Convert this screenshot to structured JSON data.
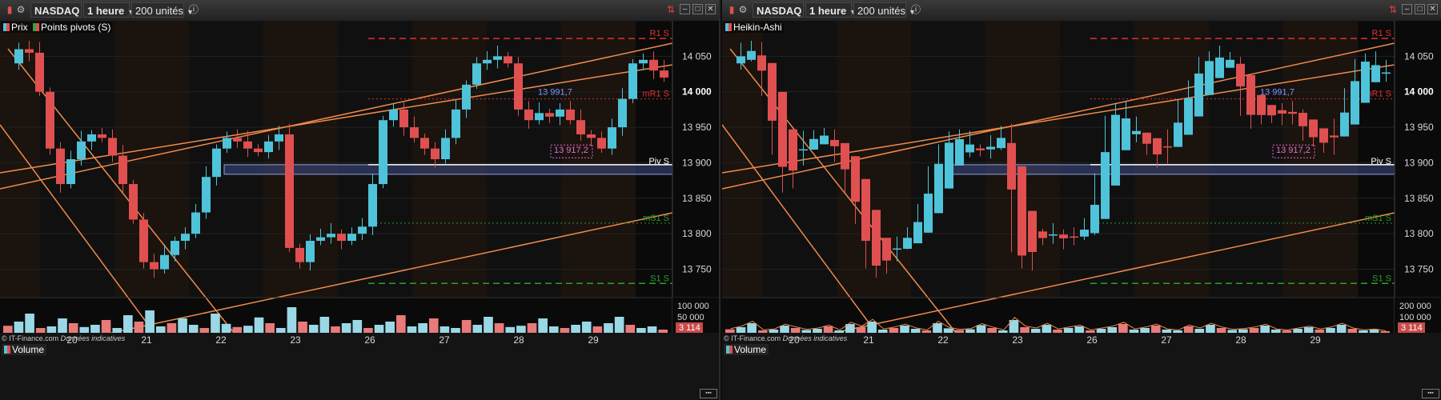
{
  "panels": [
    {
      "id": "left",
      "toolbar": {
        "market": "NASDAQ",
        "timeframe": "1 heure",
        "units": "200 unités"
      },
      "legend": [
        {
          "label": "Prix",
          "colors": [
            "#4fc3d9",
            "#e05050"
          ]
        },
        {
          "label": "Points pivots (S)",
          "colors": [
            "#3aa040",
            "#e05050"
          ]
        }
      ],
      "volume_label": "Volume",
      "credit": {
        "source": "© IT-Finance.com",
        "note": "Données indicatives"
      }
    },
    {
      "id": "right",
      "toolbar": {
        "market": "NASDAQ",
        "timeframe": "1 heure",
        "units": "200 unités"
      },
      "legend": [
        {
          "label": "Heikin-Ashi",
          "colors": [
            "#4fc3d9",
            "#e05050"
          ]
        }
      ],
      "volume_label": "Volume",
      "credit": {
        "source": "© IT-Finance.com",
        "note": "Données indicatives"
      }
    }
  ],
  "chart_data": [
    {
      "type": "candlestick",
      "panel": "left",
      "title": "NASDAQ",
      "x_ticks": [
        "20",
        "21",
        "22",
        "23",
        "26",
        "27",
        "28",
        "29"
      ],
      "y_ticks": [
        "14 050",
        "14 000",
        "13 950",
        "13 900",
        "13 850",
        "13 800",
        "13 750"
      ],
      "ylim": [
        13710,
        14100
      ],
      "current_price_label": "14 000",
      "price_path": [
        14040,
        14060,
        14055,
        14000,
        13920,
        13870,
        13905,
        13930,
        13940,
        13935,
        13910,
        13870,
        13820,
        13760,
        13750,
        13770,
        13790,
        13800,
        13830,
        13880,
        13920,
        13935,
        13930,
        13920,
        13915,
        13930,
        13940,
        13780,
        13760,
        13790,
        13795,
        13800,
        13790,
        13800,
        13810,
        13870,
        13960,
        13975,
        13950,
        13935,
        13920,
        13905,
        13935,
        13975,
        14010,
        14040,
        14045,
        14050,
        14040,
        13975,
        13960,
        13970,
        13965,
        13975,
        13960,
        13940,
        13935,
        13920,
        13950,
        13990,
        14040,
        14045,
        14030,
        14020
      ],
      "pivot_levels": [
        {
          "name": "R1 S",
          "value": 14075,
          "color": "#e03030"
        },
        {
          "name": "mR1 S",
          "value": 13990,
          "color": "#e03030"
        },
        {
          "name": "Piv S",
          "value": 13895,
          "color": "#ffffff"
        },
        {
          "name": "mS1 S",
          "value": 13815,
          "color": "#2a9a2a"
        },
        {
          "name": "S1 S",
          "value": 13730,
          "color": "#2aa02a"
        }
      ],
      "annotations": [
        "13 991,7",
        "13 917,2"
      ],
      "volume": {
        "y_ticks": [
          "100 000",
          "50 000"
        ],
        "current_label": "3 114",
        "values": [
          22000,
          35000,
          60000,
          15000,
          20000,
          45000,
          30000,
          18000,
          25000,
          40000,
          15000,
          55000,
          35000,
          70000,
          20000,
          30000,
          45000,
          25000,
          15000,
          60000,
          28000,
          18000,
          22000,
          48000,
          30000,
          15000,
          80000,
          35000,
          25000,
          50000,
          20000,
          30000,
          40000,
          15000,
          25000,
          35000,
          55000,
          20000,
          30000,
          45000,
          20000,
          15000,
          40000,
          25000,
          50000,
          30000,
          18000,
          22000,
          30000,
          45000,
          20000,
          15000,
          25000,
          35000,
          20000,
          30000,
          50000,
          25000,
          15000,
          20000,
          10000
        ]
      }
    },
    {
      "type": "heikin-ashi",
      "panel": "right",
      "title": "Heikin-Ashi",
      "x_ticks": [
        "20",
        "21",
        "22",
        "23",
        "26",
        "27",
        "28",
        "29"
      ],
      "y_ticks": [
        "14 050",
        "14 000",
        "13 950",
        "13 900",
        "13 850",
        "13 800",
        "13 750"
      ],
      "ylim": [
        13710,
        14100
      ],
      "current_price_label": "14 000",
      "price_path": [
        14040,
        14060,
        14055,
        14000,
        13920,
        13870,
        13905,
        13930,
        13940,
        13935,
        13910,
        13870,
        13820,
        13760,
        13750,
        13770,
        13790,
        13800,
        13830,
        13880,
        13920,
        13935,
        13930,
        13920,
        13915,
        13930,
        13940,
        13780,
        13760,
        13790,
        13795,
        13800,
        13790,
        13800,
        13810,
        13870,
        13960,
        13975,
        13950,
        13935,
        13920,
        13905,
        13935,
        13975,
        14010,
        14040,
        14045,
        14050,
        14040,
        13975,
        13960,
        13970,
        13965,
        13975,
        13960,
        13940,
        13935,
        13920,
        13950,
        13990,
        14040,
        14045,
        14030,
        14020
      ],
      "pivot_levels": [
        {
          "name": "R1 S",
          "value": 14075,
          "color": "#e03030"
        },
        {
          "name": "mR1 S",
          "value": 13990,
          "color": "#e03030"
        },
        {
          "name": "Piv S",
          "value": 13895,
          "color": "#ffffff"
        },
        {
          "name": "mS1 S",
          "value": 13815,
          "color": "#2a9a2a"
        },
        {
          "name": "S1 S",
          "value": 13730,
          "color": "#2aa02a"
        }
      ],
      "annotations": [
        "13 991,7",
        "13 917,2"
      ],
      "volume": {
        "y_ticks": [
          "200 000",
          "100 000"
        ],
        "current_label": "3 114",
        "values": [
          22000,
          35000,
          60000,
          15000,
          20000,
          45000,
          30000,
          18000,
          25000,
          40000,
          15000,
          55000,
          35000,
          70000,
          20000,
          30000,
          45000,
          25000,
          15000,
          60000,
          28000,
          18000,
          22000,
          48000,
          30000,
          15000,
          80000,
          35000,
          25000,
          50000,
          20000,
          30000,
          40000,
          15000,
          25000,
          35000,
          55000,
          20000,
          30000,
          45000,
          20000,
          15000,
          40000,
          25000,
          50000,
          30000,
          18000,
          22000,
          30000,
          45000,
          20000,
          15000,
          25000,
          35000,
          20000,
          30000,
          50000,
          25000,
          15000,
          20000,
          10000
        ]
      }
    }
  ]
}
